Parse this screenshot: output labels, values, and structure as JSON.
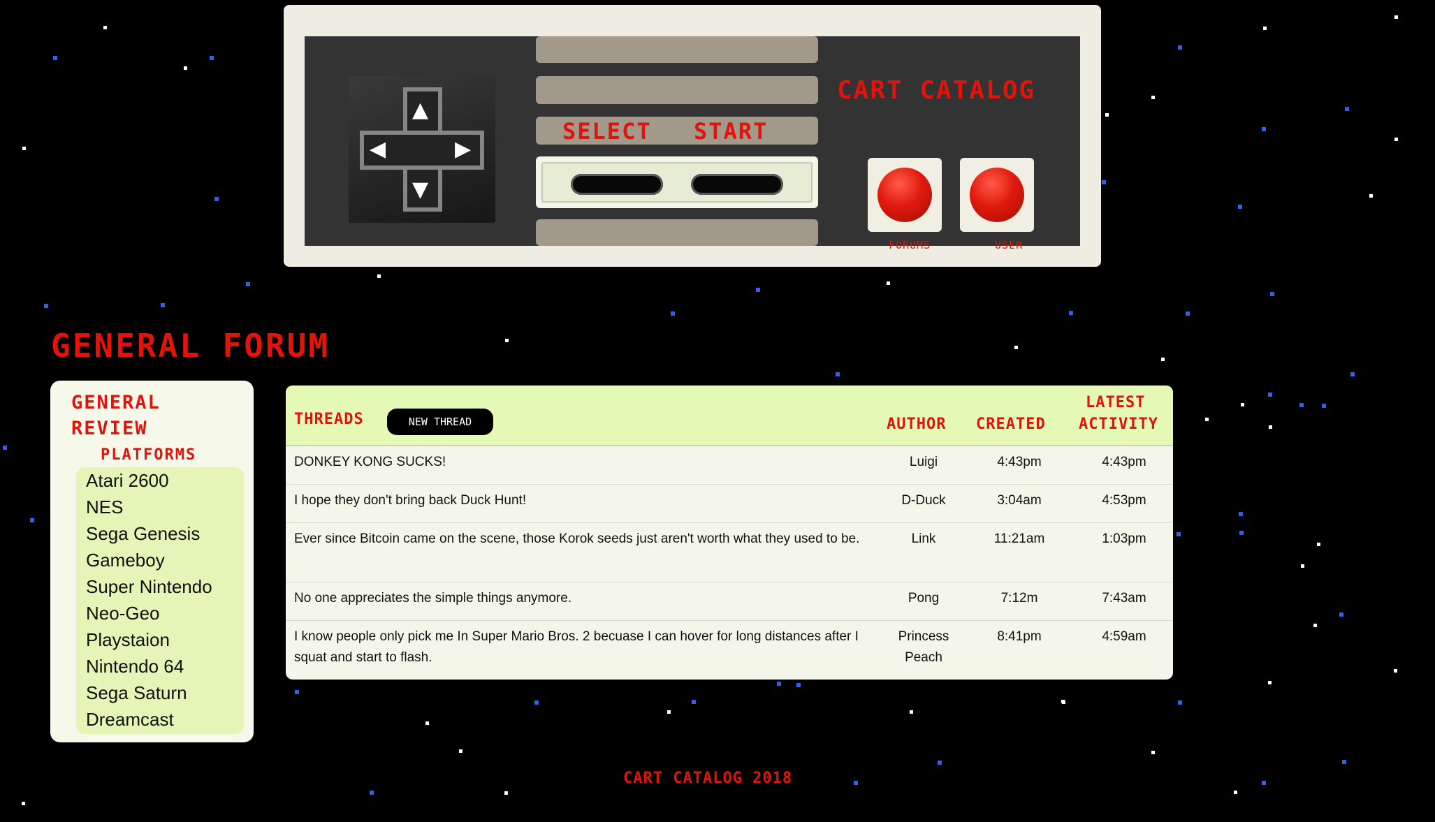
{
  "controller": {
    "site_title": "CART CATALOG",
    "select_label": "SELECT",
    "start_label": "START",
    "forums_label": "FORUMS",
    "user_label": "USER"
  },
  "forum": {
    "title": "GENERAL FORUM"
  },
  "sidebar": {
    "heading_general": "GENERAL",
    "heading_review": "REVIEW",
    "heading_platforms": "PLATFORMS",
    "platforms": [
      "Atari 2600",
      "NES",
      "Sega Genesis",
      "Gameboy",
      "Super Nintendo",
      "Neo-Geo",
      "Playstaion",
      "Nintendo 64",
      "Sega Saturn",
      "Dreamcast"
    ]
  },
  "threads_table": {
    "threads_label": "THREADS",
    "new_thread_label": "NEW THREAD",
    "author_header": "AUTHOR",
    "created_header": "CREATED",
    "latest_header_line1": "LATEST",
    "latest_header_line2": "ACTIVITY",
    "rows": [
      {
        "title": "DONKEY KONG SUCKS!",
        "author": "Luigi",
        "created": "4:43pm",
        "latest": "4:43pm"
      },
      {
        "title": "I hope they don't bring back Duck Hunt!",
        "author": "D-Duck",
        "created": "3:04am",
        "latest": "4:53pm"
      },
      {
        "title": "Ever since Bitcoin came on the scene, those Korok seeds just aren't worth what they used to be.",
        "author": "Link",
        "created": "11:21am",
        "latest": "1:03pm"
      },
      {
        "title": "No one appreciates the simple things anymore.",
        "author": "Pong",
        "created": "7:12m",
        "latest": "7:43am"
      },
      {
        "title": "I know people only pick me In Super Mario Bros. 2 becuase I can hover for long distances after I squat and start to flash.",
        "author": "Princess Peach",
        "created": "8:41pm",
        "latest": "4:59am"
      }
    ]
  },
  "footer": {
    "text": "CART CATALOG 2018"
  },
  "colors": {
    "accent_red": "#e3120b",
    "background": "#000000",
    "panel_green": "#e5f9b6"
  }
}
